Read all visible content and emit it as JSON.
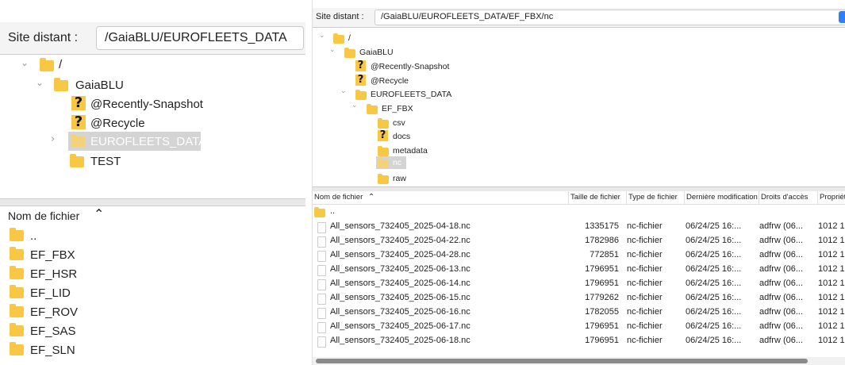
{
  "left": {
    "site_label": "Site distant :",
    "site_path": "/GaiaBLU/EUROFLEETS_DATA",
    "tree": {
      "root": "/",
      "gaia": "GaiaBLU",
      "recently": "@Recently-Snapshot",
      "recycle": "@Recycle",
      "eurofleets": "EUROFLEETS_DATA",
      "test": "TEST"
    },
    "list_header": "Nom de fichier",
    "files": [
      "..",
      "EF_FBX",
      "EF_HSR",
      "EF_LID",
      "EF_ROV",
      "EF_SAS",
      "EF_SLN"
    ]
  },
  "right": {
    "site_label": "Site distant :",
    "site_path": "/GaiaBLU/EUROFLEETS_DATA/EF_FBX/nc",
    "tree": {
      "root": "/",
      "gaia": "GaiaBLU",
      "recently": "@Recently-Snapshot",
      "recycle": "@Recycle",
      "eurofleets": "EUROFLEETS_DATA",
      "ef_fbx": "EF_FBX",
      "csv": "csv",
      "docs": "docs",
      "metadata": "metadata",
      "nc": "nc",
      "raw": "raw"
    },
    "columns": {
      "name": "Nom de fichier",
      "size": "Taille de fichier",
      "type": "Type de fichier",
      "modified": "Dernière modification",
      "perms": "Droits d'accès",
      "owner": "Propriétaire"
    },
    "parent": "..",
    "rows": [
      {
        "name": "All_sensors_732405_2025-04-18.nc",
        "size": "1335175",
        "type": "nc-fichier",
        "modified": "06/24/25 16:...",
        "perms": "adfrw (06...",
        "owner": "1012 1"
      },
      {
        "name": "All_sensors_732405_2025-04-22.nc",
        "size": "1782986",
        "type": "nc-fichier",
        "modified": "06/24/25 16:...",
        "perms": "adfrw (06...",
        "owner": "1012 1"
      },
      {
        "name": "All_sensors_732405_2025-04-28.nc",
        "size": "772851",
        "type": "nc-fichier",
        "modified": "06/24/25 16:...",
        "perms": "adfrw (06...",
        "owner": "1012 1"
      },
      {
        "name": "All_sensors_732405_2025-06-13.nc",
        "size": "1796951",
        "type": "nc-fichier",
        "modified": "06/24/25 16:...",
        "perms": "adfrw (06...",
        "owner": "1012 1"
      },
      {
        "name": "All_sensors_732405_2025-06-14.nc",
        "size": "1796951",
        "type": "nc-fichier",
        "modified": "06/24/25 16:...",
        "perms": "adfrw (06...",
        "owner": "1012 1"
      },
      {
        "name": "All_sensors_732405_2025-06-15.nc",
        "size": "1779262",
        "type": "nc-fichier",
        "modified": "06/24/25 16:...",
        "perms": "adfrw (06...",
        "owner": "1012 1"
      },
      {
        "name": "All_sensors_732405_2025-06-16.nc",
        "size": "1782055",
        "type": "nc-fichier",
        "modified": "06/24/25 16:...",
        "perms": "adfrw (06...",
        "owner": "1012 1"
      },
      {
        "name": "All_sensors_732405_2025-06-17.nc",
        "size": "1796951",
        "type": "nc-fichier",
        "modified": "06/24/25 16:...",
        "perms": "adfrw (06...",
        "owner": "1012 1"
      },
      {
        "name": "All_sensors_732405_2025-06-18.nc",
        "size": "1796951",
        "type": "nc-fichier",
        "modified": "06/24/25 16:...",
        "perms": "adfrw (06...",
        "owner": "1012 1"
      }
    ]
  },
  "colors": {
    "folder": "#f8c744",
    "selection": "#d4d4d4",
    "accent": "#2f7ff5"
  }
}
